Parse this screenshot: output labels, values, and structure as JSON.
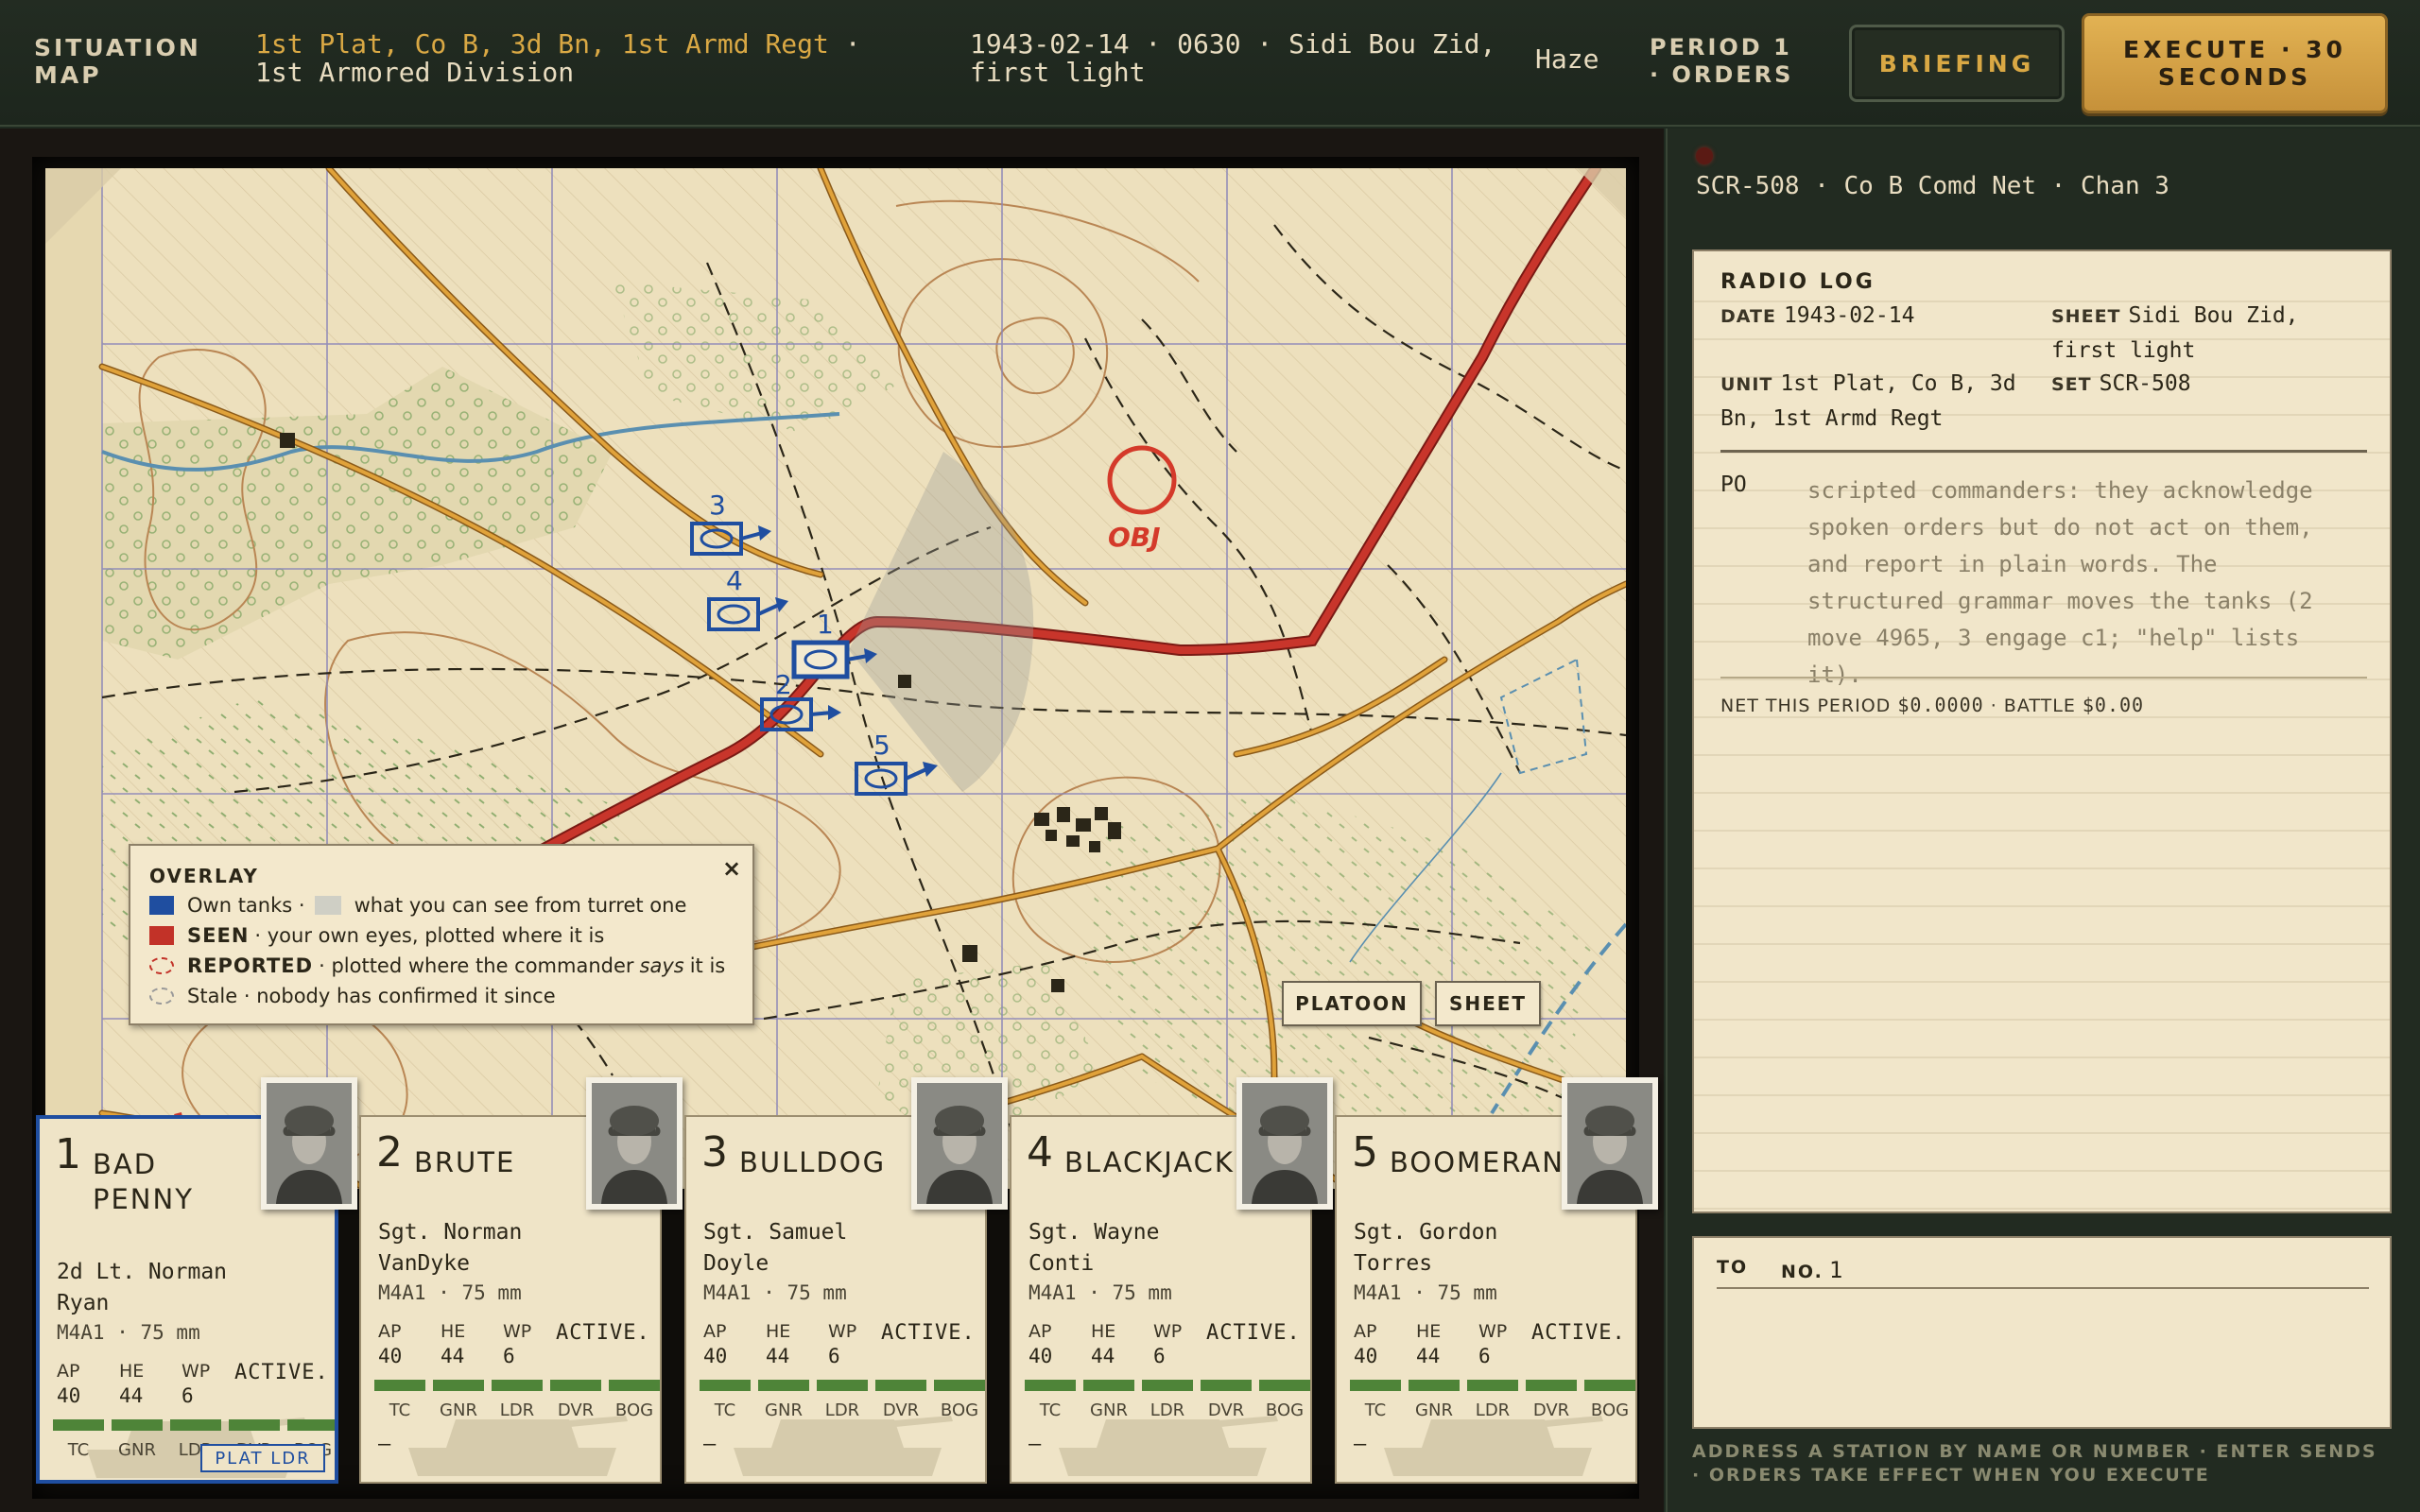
{
  "header": {
    "title": "SITUATION MAP",
    "unit_highlight": "1st Plat, Co B, 3d Bn, 1st Armd Regt",
    "unit_rest": " · 1st Armored Division",
    "datetime_place": "1943-02-14 · 0630 · Sidi Bou Zid, first light",
    "weather": "Haze",
    "period": "PERIOD 1 · ORDERS",
    "briefing_label": "BRIEFING",
    "execute_label": "EXECUTE · 30 SECONDS"
  },
  "map": {
    "objective_label": "OBJ",
    "tank_markers": [
      "1",
      "2",
      "3",
      "4",
      "5"
    ],
    "buttons": {
      "platoon": "PLATOON",
      "sheet": "SHEET"
    },
    "overlay": {
      "title": "OVERLAY",
      "close": "×",
      "own_tanks": "Own tanks ·",
      "turret_view": "what you can see from turret one",
      "seen_key": "SEEN",
      "seen_text": "· your own eyes, plotted where it is",
      "reported_key": "REPORTED",
      "reported_pre": "· plotted where the commander",
      "reported_says": "says",
      "reported_post": "it is",
      "stale_text": "Stale · nobody has confirmed it since"
    },
    "colors": {
      "own": "#1f4ea0",
      "seen": "#c23228",
      "road_main": "#c8352b",
      "road": "#d69a2e",
      "water": "#5a8fb0"
    }
  },
  "tanks": [
    {
      "num": "1",
      "name": "BAD PENNY",
      "commander": "2d Lt. Norman Ryan",
      "vehicle": "M4A1 · 75 mm",
      "ap_label": "AP",
      "ap": "40",
      "he_label": "HE",
      "he": "44",
      "wp_label": "WP",
      "wp": "6",
      "status": "ACTIVE.",
      "crew": [
        "TC",
        "GNR",
        "LDR",
        "DVR",
        "BOG"
      ],
      "note": "—",
      "badge": "PLAT LDR",
      "selected": true
    },
    {
      "num": "2",
      "name": "BRUTE",
      "commander": "Sgt. Norman VanDyke",
      "vehicle": "M4A1 · 75 mm",
      "ap_label": "AP",
      "ap": "40",
      "he_label": "HE",
      "he": "44",
      "wp_label": "WP",
      "wp": "6",
      "status": "ACTIVE.",
      "crew": [
        "TC",
        "GNR",
        "LDR",
        "DVR",
        "BOG"
      ],
      "note": "—"
    },
    {
      "num": "3",
      "name": "BULLDOG",
      "commander": "Sgt. Samuel Doyle",
      "vehicle": "M4A1 · 75 mm",
      "ap_label": "AP",
      "ap": "40",
      "he_label": "HE",
      "he": "44",
      "wp_label": "WP",
      "wp": "6",
      "status": "ACTIVE.",
      "crew": [
        "TC",
        "GNR",
        "LDR",
        "DVR",
        "BOG"
      ],
      "note": "—"
    },
    {
      "num": "4",
      "name": "BLACKJACK",
      "commander": "Sgt. Wayne Conti",
      "vehicle": "M4A1 · 75 mm",
      "ap_label": "AP",
      "ap": "40",
      "he_label": "HE",
      "he": "44",
      "wp_label": "WP",
      "wp": "6",
      "status": "ACTIVE.",
      "crew": [
        "TC",
        "GNR",
        "LDR",
        "DVR",
        "BOG"
      ],
      "note": "—"
    },
    {
      "num": "5",
      "name": "BOOMERANG",
      "commander": "Sgt. Gordon Torres",
      "vehicle": "M4A1 · 75 mm",
      "ap_label": "AP",
      "ap": "40",
      "he_label": "HE",
      "he": "44",
      "wp_label": "WP",
      "wp": "6",
      "status": "ACTIVE.",
      "crew": [
        "TC",
        "GNR",
        "LDR",
        "DVR",
        "BOG"
      ],
      "note": "—"
    }
  ],
  "radio": {
    "net": "SCR-508 · Co B Comd Net · Chan 3",
    "log_title": "RADIO LOG",
    "date_key": "DATE",
    "date": "1943-02-14",
    "sheet_key": "SHEET",
    "sheet": "Sidi Bou Zid, first light",
    "unit_key": "UNIT",
    "unit": "1st Plat, Co B, 3d Bn, 1st Armd Regt",
    "set_key": "SET",
    "set": "SCR-508",
    "po_key": "PO",
    "po_text": "scripted commanders: they acknowledge spoken orders but do not act on them, and report in plain words. The structured grammar moves the tanks (2 move 4965, 3 engage c1; \"help\" lists it).",
    "net_key": "NET THIS PERIOD",
    "net_period": "$0.0000",
    "battle_key": "· BATTLE",
    "battle": "$0.00"
  },
  "compose": {
    "to_label": "TO",
    "no_label": "NO.",
    "no_value": "1",
    "message": ""
  },
  "hint": "ADDRESS A STATION BY NAME OR NUMBER · ENTER SENDS · ORDERS TAKE EFFECT WHEN YOU EXECUTE"
}
